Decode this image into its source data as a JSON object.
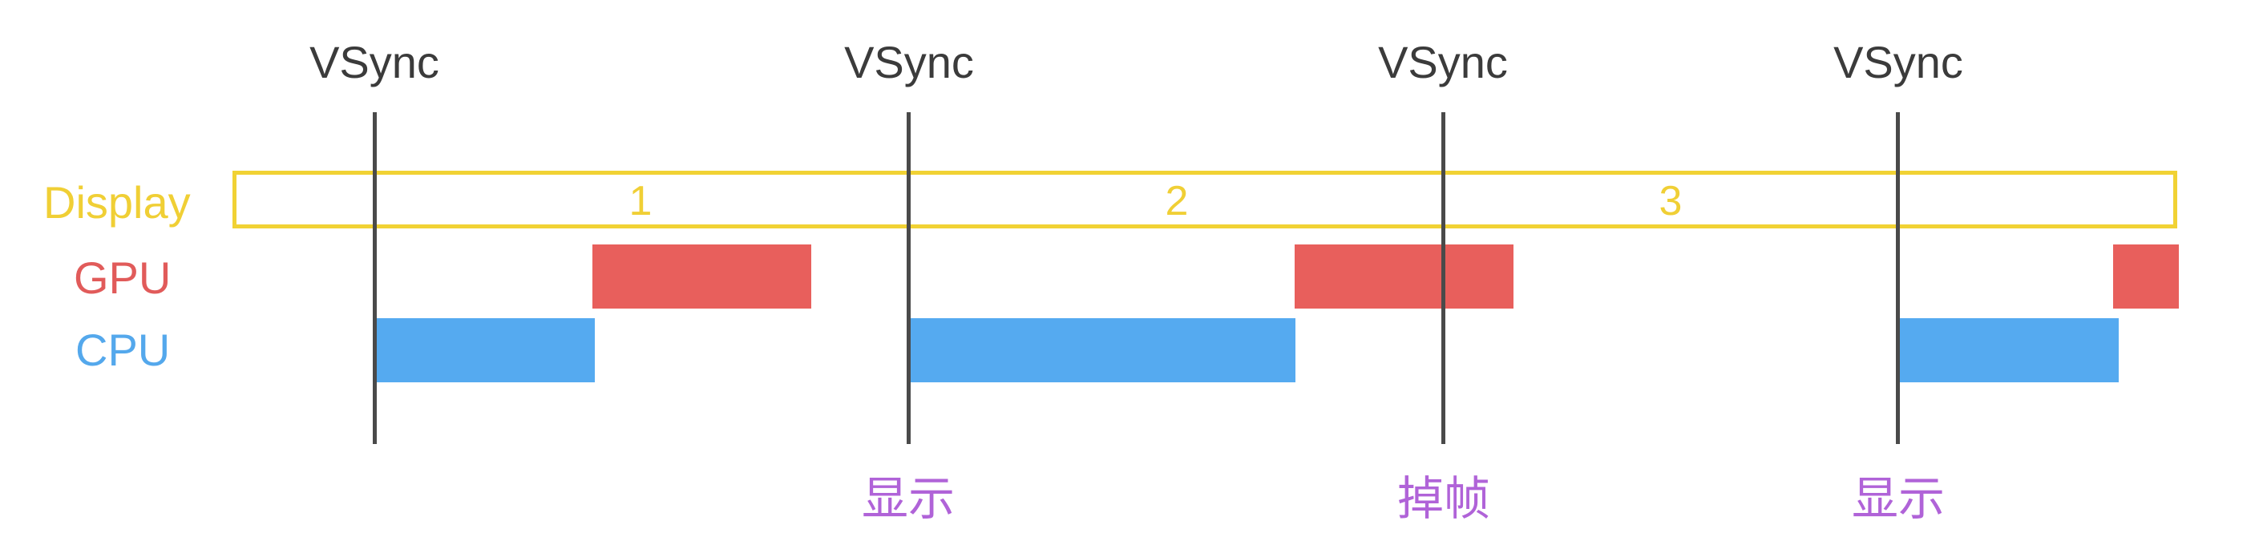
{
  "vsync": {
    "markers": [
      "VSync",
      "VSync",
      "VSync",
      "VSync"
    ]
  },
  "rows": {
    "display": "Display",
    "gpu": "GPU",
    "cpu": "CPU"
  },
  "display_frames": [
    "1",
    "2",
    "3"
  ],
  "events": [
    "显示",
    "掉帧",
    "显示"
  ],
  "colors": {
    "display": "#f1d234",
    "gpu": "#e85f5c",
    "cpu": "#55aaf0",
    "vsync_line": "#4a4a4a",
    "event_text": "#b063d8"
  }
}
